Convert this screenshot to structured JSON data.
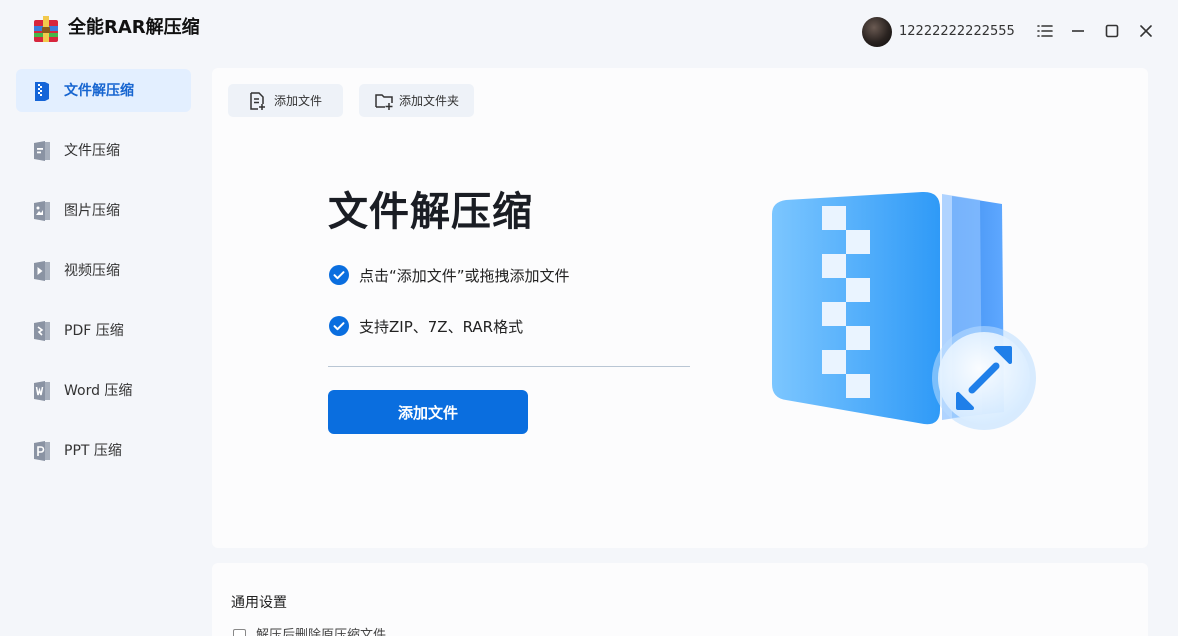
{
  "app": {
    "title": "全能RAR解压缩"
  },
  "user": {
    "name": "12222222222555"
  },
  "window_controls": [
    "menu-icon",
    "minimize-icon",
    "maximize-icon",
    "close-icon"
  ],
  "sidebar": {
    "items": [
      {
        "label": "文件解压缩",
        "icon": "archive-extract-icon",
        "active": true
      },
      {
        "label": "文件压缩",
        "icon": "file-compress-icon",
        "active": false
      },
      {
        "label": "图片压缩",
        "icon": "image-compress-icon",
        "active": false
      },
      {
        "label": "视频压缩",
        "icon": "video-compress-icon",
        "active": false
      },
      {
        "label": "PDF 压缩",
        "icon": "pdf-compress-icon",
        "active": false
      },
      {
        "label": "Word 压缩",
        "icon": "word-compress-icon",
        "active": false
      },
      {
        "label": "PPT 压缩",
        "icon": "ppt-compress-icon",
        "active": false
      }
    ]
  },
  "toolbar": {
    "add_file": "添加文件",
    "add_folder": "添加文件夹"
  },
  "hero": {
    "title": "文件解压缩",
    "features": [
      "点击“添加文件”或拖拽添加文件",
      "支持ZIP、7Z、RAR格式"
    ],
    "button": "添加文件"
  },
  "settings": {
    "title": "通用设置",
    "option": "解压后删除原压缩文件"
  },
  "colors": {
    "accent": "#0a6edf",
    "active_bg": "#e3efff",
    "background": "#f4f6fa"
  }
}
